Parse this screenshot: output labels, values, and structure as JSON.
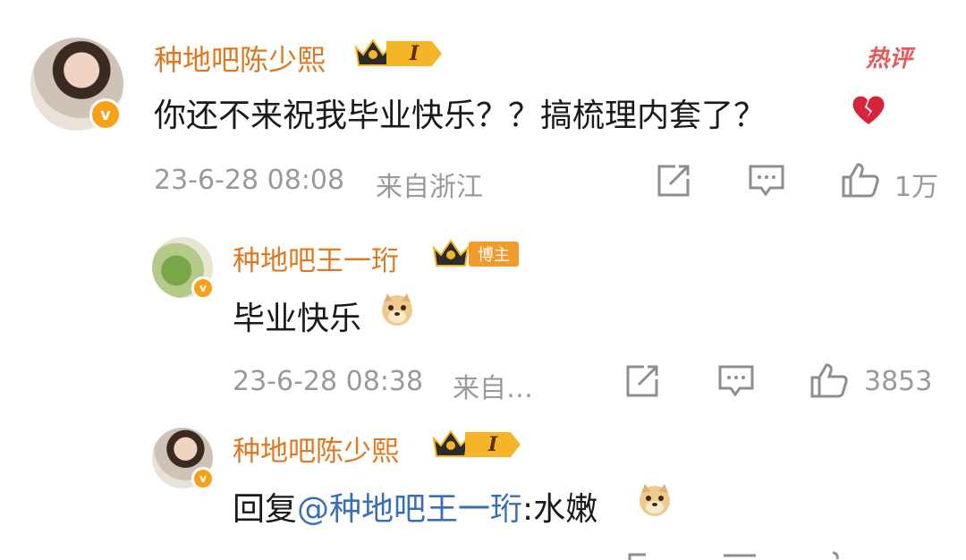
{
  "hot_label": "热评",
  "comments": [
    {
      "user": "种地吧陈少熙",
      "level_badge": "I",
      "text_main": "你还不来祝我毕业快乐？？搞梳理内套了？",
      "emoji": "broken-heart",
      "timestamp": "23-6-28 08:08",
      "location": "来自浙江",
      "likes": "1万"
    },
    {
      "user": "种地吧王一珩",
      "author_badge": "博主",
      "text_main": "毕业快乐",
      "emoji": "doge",
      "timestamp": "23-6-28 08:38",
      "location": "来自…",
      "likes": "3853"
    },
    {
      "user": "种地吧陈少熙",
      "level_badge": "I",
      "reply_prefix": "回复",
      "mention": "@种地吧王一珩",
      "reply_suffix": ":水嫩",
      "emoji": "doge"
    }
  ],
  "icons": {
    "share": "share-icon",
    "comment": "comment-icon",
    "like": "thumbs-up-icon",
    "crown": "crown-icon",
    "verified": "verified-v-icon"
  },
  "colors": {
    "name": "#e1771e",
    "meta": "#9a9a9a",
    "mention": "#3b6fb5",
    "hot": "#e8575a"
  }
}
